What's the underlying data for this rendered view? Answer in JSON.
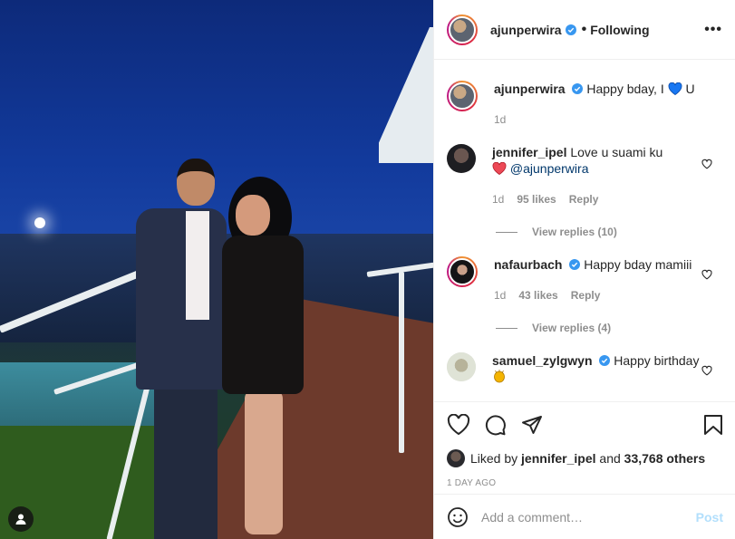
{
  "post": {
    "author": "ajunperwira",
    "follow_status": "Following",
    "more_label": "•••"
  },
  "caption": {
    "user": "ajunperwira",
    "text_before": "Happy bday, I",
    "text_after": "U",
    "time": "1d"
  },
  "comments": [
    {
      "user": "jennifer_ipel",
      "text": "Love u suami ku",
      "mention": "@ajunperwira",
      "time": "1d",
      "likes": "95 likes",
      "reply": "Reply",
      "view_replies": "View replies (10)"
    },
    {
      "user": "nafaurbach",
      "text": "Happy bday mamiii",
      "time": "1d",
      "likes": "43 likes",
      "reply": "Reply",
      "view_replies": "View replies (4)"
    },
    {
      "user": "samuel_zylgwyn",
      "text": "Happy birthday"
    }
  ],
  "likes": {
    "prefix": "Liked by",
    "user": "jennifer_ipel",
    "middle": "and",
    "count": "33,768 others"
  },
  "timestamp": "1 DAY AGO",
  "add_comment": {
    "placeholder": "Add a comment…",
    "post_label": "Post"
  },
  "colors": {
    "verified": "#3897f0",
    "heart_red": "#ed4956",
    "heart_blue": "#1877f2",
    "post_button_disabled": "#b2dffc"
  }
}
